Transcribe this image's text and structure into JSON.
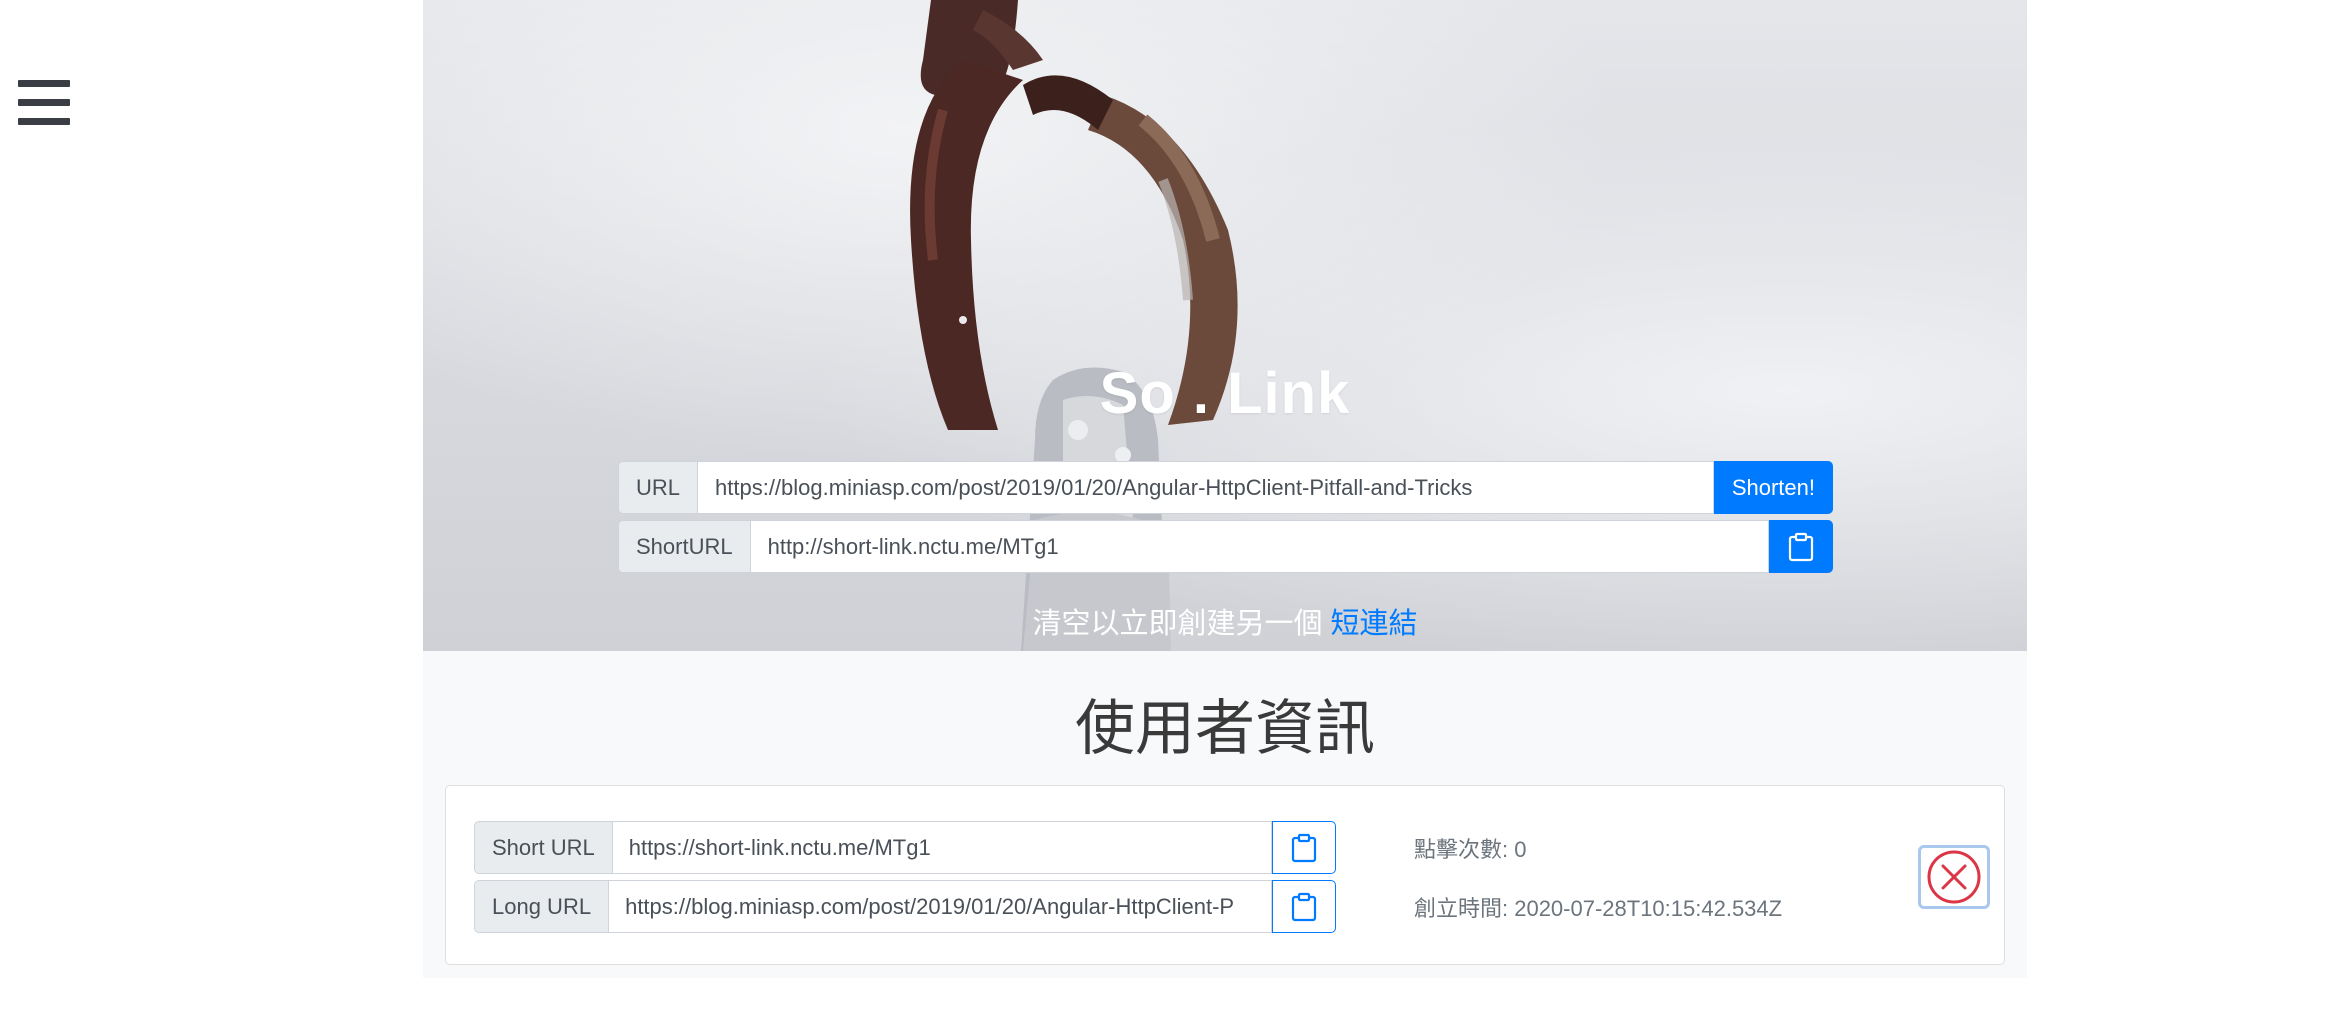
{
  "nav": {
    "menu_icon": "hamburger-menu-icon"
  },
  "hero": {
    "brand": "So . Link",
    "url_label": "URL",
    "url_value": "https://blog.miniasp.com/post/2019/01/20/Angular-HttpClient-Pitfall-and-Tricks",
    "shorten_label": "Shorten!",
    "short_label": "ShortURL",
    "short_value": "http://short-link.nctu.me/MTg1",
    "copy_icon": "clipboard-icon",
    "hint_text": "清空以立即創建另一個",
    "hint_link": "短連結"
  },
  "user_info": {
    "title": "使用者資訊",
    "item": {
      "short_label": "Short URL",
      "short_value": "https://short-link.nctu.me/MTg1",
      "long_label": "Long URL",
      "long_value": "https://blog.miniasp.com/post/2019/01/20/Angular-HttpClient-P",
      "clicks": "點擊次數: 0",
      "created": "創立時間: 2020-07-28T10:15:42.534Z",
      "delete_icon": "close-circle-icon"
    }
  },
  "colors": {
    "primary": "#007bff",
    "danger": "#dc3545",
    "addon_bg": "#e9ecef",
    "section_bg": "#f8f9fa"
  }
}
